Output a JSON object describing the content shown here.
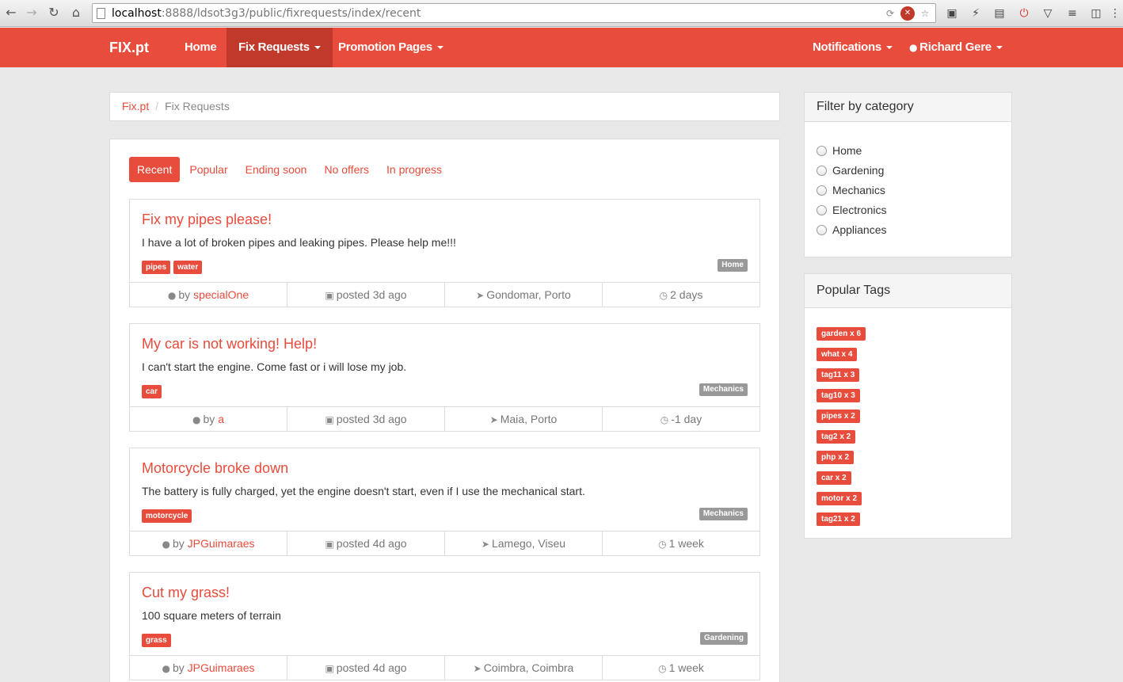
{
  "browser": {
    "url_host": "localhost",
    "url_rest": ":8888/ldsot3g3/public/fixrequests/index/recent"
  },
  "navbar": {
    "brand": "FIX.pt",
    "items": [
      {
        "label": "Home"
      },
      {
        "label": "Fix Requests"
      },
      {
        "label": "Promotion Pages"
      }
    ],
    "right": [
      {
        "label": "Notifications"
      },
      {
        "label": "Richard Gere"
      }
    ]
  },
  "breadcrumb": {
    "root": "Fix.pt",
    "separator": "/",
    "current": "Fix Requests"
  },
  "tabs": [
    {
      "label": "Recent"
    },
    {
      "label": "Popular"
    },
    {
      "label": "Ending soon"
    },
    {
      "label": "No offers"
    },
    {
      "label": "In progress"
    }
  ],
  "requests": [
    {
      "title": "Fix my pipes please!",
      "description": "I have a lot of broken pipes and leaking pipes. Please help me!!!",
      "tags": [
        "pipes",
        "water"
      ],
      "category": "Home",
      "by": "by",
      "author": "specialOne",
      "posted": "posted 3d ago",
      "location": "Gondomar, Porto",
      "time": "2 days"
    },
    {
      "title": "My car is not working! Help!",
      "description": "I can't start the engine. Come fast or i will lose my job.",
      "tags": [
        "car"
      ],
      "category": "Mechanics",
      "by": "by",
      "author": "a",
      "posted": "posted 3d ago",
      "location": "Maia, Porto",
      "time": "-1 day"
    },
    {
      "title": "Motorcycle broke down",
      "description": "The battery is fully charged, yet the engine doesn't start, even if I use the mechanical start.",
      "tags": [
        "motorcycle"
      ],
      "category": "Mechanics",
      "by": "by",
      "author": "JPGuimaraes",
      "posted": "posted 4d ago",
      "location": "Lamego, Viseu",
      "time": "1 week"
    },
    {
      "title": "Cut my grass!",
      "description": "100 square meters of terrain",
      "tags": [
        "grass"
      ],
      "category": "Gardening",
      "by": "by",
      "author": "JPGuimaraes",
      "posted": "posted 4d ago",
      "location": "Coimbra, Coimbra",
      "time": "1 week"
    }
  ],
  "filter": {
    "title": "Filter by category",
    "options": [
      "Home",
      "Gardening",
      "Mechanics",
      "Electronics",
      "Appliances"
    ]
  },
  "popular_tags": {
    "title": "Popular Tags",
    "items": [
      "garden x 6",
      "what x 4",
      "tag11 x 3",
      "tag10 x 3",
      "pipes x 2",
      "tag2 x 2",
      "php x 2",
      "car x 2",
      "motor x 2",
      "tag21 x 2"
    ]
  },
  "colors": {
    "accent": "#e74c3c",
    "accent_dark": "#c0392b",
    "category_badge": "#999999"
  }
}
